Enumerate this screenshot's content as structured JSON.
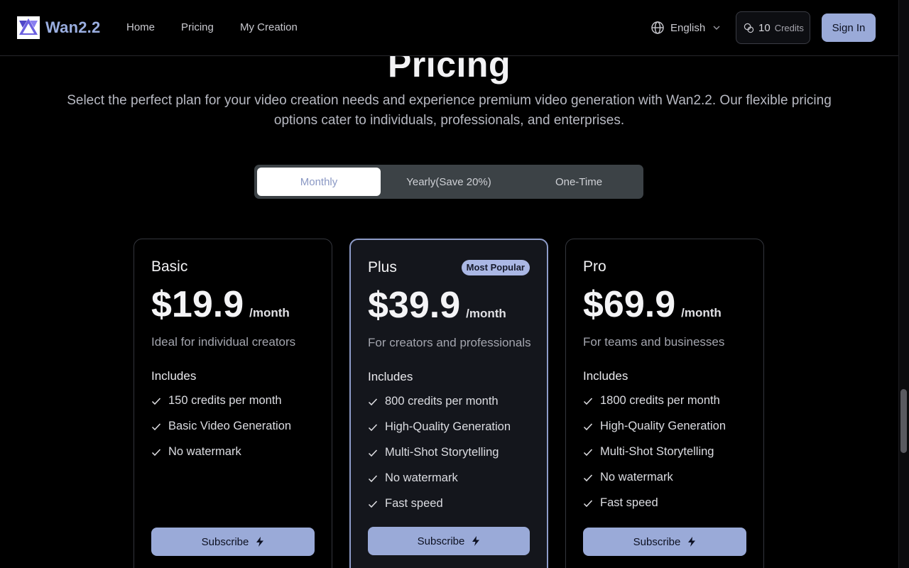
{
  "header": {
    "brand": "Wan2.2",
    "nav": [
      "Home",
      "Pricing",
      "My Creation"
    ],
    "language": "English",
    "credits_count": "10",
    "credits_label": "Credits",
    "sign_in": "Sign In"
  },
  "hero": {
    "title": "Pricing",
    "subtitle": "Select the perfect plan for your video creation needs and experience premium video generation with Wan2.2. Our flexible pricing options cater to individuals, professionals, and enterprises."
  },
  "billing": {
    "options": [
      "Monthly",
      "Yearly(Save 20%)",
      "One-Time"
    ],
    "selected": "Monthly"
  },
  "plans": [
    {
      "name": "Basic",
      "price": "$19.9",
      "period": "/month",
      "description": "Ideal for individual creators",
      "includes_label": "Includes",
      "features": [
        "150 credits per month",
        "Basic Video Generation",
        "No watermark"
      ],
      "cta": "Subscribe"
    },
    {
      "name": "Plus",
      "badge": "Most Popular",
      "price": "$39.9",
      "period": "/month",
      "description": "For creators and professionals",
      "includes_label": "Includes",
      "features": [
        "800 credits per month",
        "High-Quality Generation",
        "Multi-Shot Storytelling",
        "No watermark",
        "Fast speed"
      ],
      "cta": "Subscribe"
    },
    {
      "name": "Pro",
      "price": "$69.9",
      "period": "/month",
      "description": "For teams and businesses",
      "includes_label": "Includes",
      "features": [
        "1800 credits per month",
        "High-Quality Generation",
        "Multi-Shot Storytelling",
        "No watermark",
        "Fast speed"
      ],
      "cta": "Subscribe"
    }
  ],
  "colors": {
    "accent": "#9aaad8",
    "brand": "#9aaee0",
    "background": "#000000",
    "popular_border": "#8e9cc9"
  }
}
